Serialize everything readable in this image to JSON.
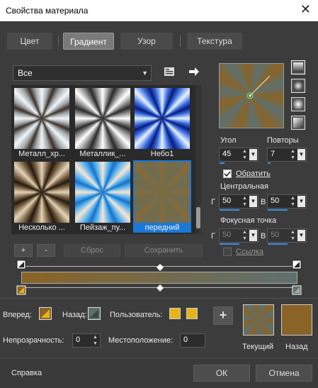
{
  "window": {
    "title": "Свойства материала",
    "close_glyph": "✕"
  },
  "tabs": [
    {
      "label": "Цвет",
      "active": false
    },
    {
      "label": "Градиент",
      "active": true
    },
    {
      "label": "Узор",
      "active": false
    },
    {
      "label": "Текстура",
      "active": false
    }
  ],
  "category": {
    "value": "Все",
    "arrow": "▼"
  },
  "gallery": [
    {
      "label": "Металл_хр...",
      "colors": [
        "#f0f6fa",
        "#9fa4a6",
        "#3c2f26"
      ]
    },
    {
      "label": "Металлик_...",
      "colors": [
        "#ffffff",
        "#8a8a8a",
        "#2a2a2a"
      ]
    },
    {
      "label": "Небо1",
      "colors": [
        "#e8f2ff",
        "#3a6fe0",
        "#0b1a7a"
      ]
    },
    {
      "label": "Несколько ...",
      "colors": [
        "#e2d2b8",
        "#7a6244",
        "#241a10"
      ]
    },
    {
      "label": "Пейзаж_пу...",
      "colors": [
        "#f8e4d0",
        "#5ab4f0",
        "#1872c8"
      ]
    },
    {
      "label": "передний",
      "colors": [
        "#8a6a32",
        "#6a6e5a",
        "#7c6a3c"
      ],
      "selected": true
    }
  ],
  "gallery_buttons": {
    "add": "+",
    "remove": "-",
    "reset": "Сброс",
    "save": "Сохранить"
  },
  "preview": {
    "colors": [
      "#8a6426",
      "#5e7070"
    ]
  },
  "angle": {
    "label": "Угол",
    "value": "45",
    "fill": 0.125
  },
  "repeats": {
    "label": "Повторы",
    "value": "7",
    "fill": 0.07
  },
  "invert": {
    "label": "Обратить",
    "checked": true
  },
  "center": {
    "label": "Центральная",
    "h_label": "Г",
    "h_value": "50",
    "v_label": "В",
    "v_value": "50"
  },
  "focal": {
    "label": "Фокусная точка",
    "h_label": "Г",
    "h_value": "50",
    "v_label": "В",
    "v_value": "50",
    "link_label": "Ссылка"
  },
  "gradient_bar": {
    "colors": [
      "#8a6426",
      "#5e7070"
    ]
  },
  "forward": {
    "label": "Вперед:"
  },
  "backward": {
    "label": "Назад:"
  },
  "user": {
    "label": "Пользователь:",
    "color": "#e8b31a"
  },
  "opacity": {
    "label": "Непрозрачность:",
    "value": "0"
  },
  "location": {
    "label": "Местоположение:",
    "value": "0"
  },
  "current": {
    "label": "Текущий",
    "add_glyph": "+"
  },
  "back_swatch": {
    "label": "Назад",
    "color": "#8a6426"
  },
  "footer": {
    "help": "Справка",
    "ok": "ОК",
    "cancel": "Отмена"
  }
}
